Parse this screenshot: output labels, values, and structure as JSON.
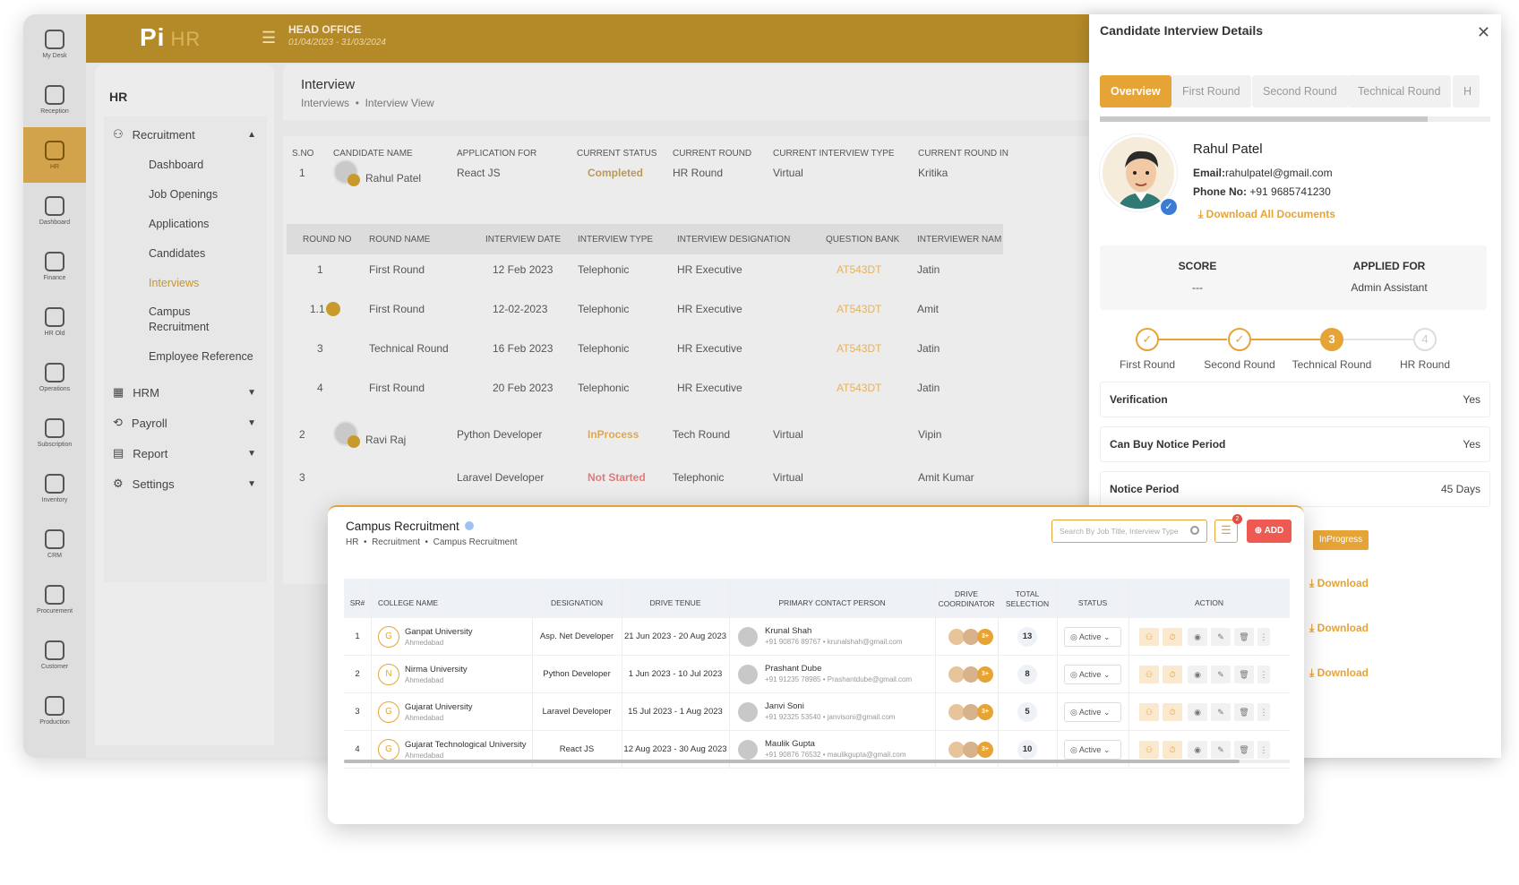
{
  "brand": {
    "logo": "Pi",
    "logo_sub": "HR"
  },
  "topbar": {
    "office": "HEAD OFFICE",
    "dates": "01/04/2023 - 31/03/2024"
  },
  "rail": [
    {
      "label": "My Desk",
      "icon": "desk-icon"
    },
    {
      "label": "Reception",
      "icon": "reception-icon"
    },
    {
      "label": "HR",
      "icon": "hr-icon",
      "active": true
    },
    {
      "label": "Dashboard",
      "icon": "dashboard-icon"
    },
    {
      "label": "Finance",
      "icon": "finance-icon"
    },
    {
      "label": "HR Old",
      "icon": "hr-old-icon"
    },
    {
      "label": "Operations",
      "icon": "operations-icon"
    },
    {
      "label": "Subscription",
      "icon": "subscription-icon"
    },
    {
      "label": "Inventory",
      "icon": "inventory-icon"
    },
    {
      "label": "CRM",
      "icon": "crm-icon"
    },
    {
      "label": "Procurement",
      "icon": "procurement-icon"
    },
    {
      "label": "Customer",
      "icon": "customer-icon"
    },
    {
      "label": "Production",
      "icon": "production-icon"
    }
  ],
  "sidebar": {
    "title": "HR",
    "recruitment": "Recruitment",
    "sub": [
      "Dashboard",
      "Job Openings",
      "Applications",
      "Candidates",
      "Interviews",
      "Campus Recruitment",
      "Employee Reference"
    ],
    "groups": [
      "HRM",
      "Payroll",
      "Report",
      "Settings"
    ]
  },
  "interview": {
    "title": "Interview",
    "breadcrumb": [
      "Interviews",
      "Interview View"
    ],
    "headers": [
      "S.NO",
      "CANDIDATE NAME",
      "APPLICATION FOR",
      "CURRENT STATUS",
      "CURRENT ROUND",
      "CURRENT INTERVIEW TYPE",
      "CURRENT ROUND IN"
    ],
    "rows": [
      {
        "sno": "1",
        "name": "Rahul Patel",
        "app": "React JS",
        "status": "Completed",
        "round": "HR Round",
        "type": "Virtual",
        "interviewer": "Kritika"
      },
      {
        "sno": "2",
        "name": "Ravi Raj",
        "app": "Python Developer",
        "status": "InProcess",
        "round": "Tech Round",
        "type": "Virtual",
        "interviewer": "Vipin"
      },
      {
        "sno": "3",
        "name": "",
        "app": "Laravel Developer",
        "status": "Not Started",
        "round": "Telephonic",
        "type": "Virtual",
        "interviewer": "Amit Kumar"
      }
    ],
    "sub_headers": [
      "ROUND NO",
      "ROUND NAME",
      "INTERVIEW DATE",
      "INTERVIEW TYPE",
      "INTERVIEW DESIGNATION",
      "QUESTION BANK",
      "INTERVIEWER NAM"
    ],
    "sub_rows": [
      {
        "no": "1",
        "name": "First Round",
        "date": "12 Feb 2023",
        "type": "Telephonic",
        "desig": "HR Executive",
        "qb": "AT543DT",
        "interviewer": "Jatin"
      },
      {
        "no": "1.1",
        "name": "First Round",
        "date": "12-02-2023",
        "type": "Telephonic",
        "desig": "HR Executive",
        "qb": "AT543DT",
        "interviewer": "Amit"
      },
      {
        "no": "3",
        "name": "Technical Round",
        "date": "16 Feb 2023",
        "type": "Telephonic",
        "desig": "HR Executive",
        "qb": "AT543DT",
        "interviewer": "Jatin"
      },
      {
        "no": "4",
        "name": "First Round",
        "date": "20 Feb 2023",
        "type": "Telephonic",
        "desig": "HR Executive",
        "qb": "AT543DT",
        "interviewer": "Jatin"
      }
    ]
  },
  "drawer": {
    "title": "Candidate Interview Details",
    "tabs": [
      "Overview",
      "First Round",
      "Second Round",
      "Technical Round",
      "H"
    ],
    "name": "Rahul Patel",
    "email_label": "Email:",
    "email": "rahulpatel@gmail.com",
    "phone_label": "Phone No:",
    "phone": "+91 9685741230",
    "download_all": "Download All Documents",
    "score_label": "SCORE",
    "score": "---",
    "applied_label": "APPLIED FOR",
    "applied": "Admin Assistant",
    "steps": [
      {
        "label": "First Round",
        "mark": "✓"
      },
      {
        "label": "Second Round",
        "mark": "✓"
      },
      {
        "label": "Technical Round",
        "mark": "3"
      },
      {
        "label": "HR Round",
        "mark": "4"
      }
    ],
    "kv": [
      {
        "k": "Verification",
        "v": "Yes"
      },
      {
        "k": "Can Buy Notice Period",
        "v": "Yes"
      },
      {
        "k": "Notice Period",
        "v": "45 Days"
      }
    ],
    "inprogress": "InProgress",
    "download": "Download"
  },
  "campus": {
    "title": "Campus Recruitment",
    "breadcrumb": [
      "HR",
      "Recruitment",
      "Campus Recruitment"
    ],
    "search_placeholder": "Search By Job Title, Interview Type",
    "filter_count": "2",
    "add_label": "ADD",
    "headers": [
      "SR#",
      "COLLEGE NAME",
      "DESIGNATION",
      "DRIVE TENUE",
      "PRIMARY CONTACT PERSON",
      "DRIVE COORDINATOR",
      "TOTAL SELECTION",
      "STATUS",
      "ACTION"
    ],
    "rows": [
      {
        "sr": "1",
        "initial": "G",
        "college": "Ganpat University",
        "city": "Ahmedabad",
        "designation": "Asp. Net Developer",
        "tenure": "21 Jun 2023 - 20 Aug 2023",
        "contact": "Krunal Shah",
        "phone": "+91 90876 89767",
        "email": "krunalshah@gmail.com",
        "more": "3+",
        "total": "13",
        "status": "Active"
      },
      {
        "sr": "2",
        "initial": "N",
        "college": "Nirma University",
        "city": "Ahmedabad",
        "designation": "Python Developer",
        "tenure": "1 Jun 2023 - 10 Jul 2023",
        "contact": "Prashant Dube",
        "phone": "+91 91235 78985",
        "email": "Prashantdube@gmail.com",
        "more": "3+",
        "total": "8",
        "status": "Active"
      },
      {
        "sr": "3",
        "initial": "G",
        "college": "Gujarat University",
        "city": "Ahmedabad",
        "designation": "Laravel Developer",
        "tenure": "15 Jul 2023 - 1 Aug 2023",
        "contact": "Janvi Soni",
        "phone": "+91 92325 53540",
        "email": "janvisoni@gmail.com",
        "more": "3+",
        "total": "5",
        "status": "Active"
      },
      {
        "sr": "4",
        "initial": "G",
        "college": "Gujarat Technological University",
        "city": "Ahmedabad",
        "designation": "React JS",
        "tenure": "12 Aug 2023 - 30 Aug 2023",
        "contact": "Maulik Gupta",
        "phone": "+91 90876 76532",
        "email": "maulikgupta@gmail.com",
        "more": "3+",
        "total": "10",
        "status": "Active"
      }
    ]
  }
}
